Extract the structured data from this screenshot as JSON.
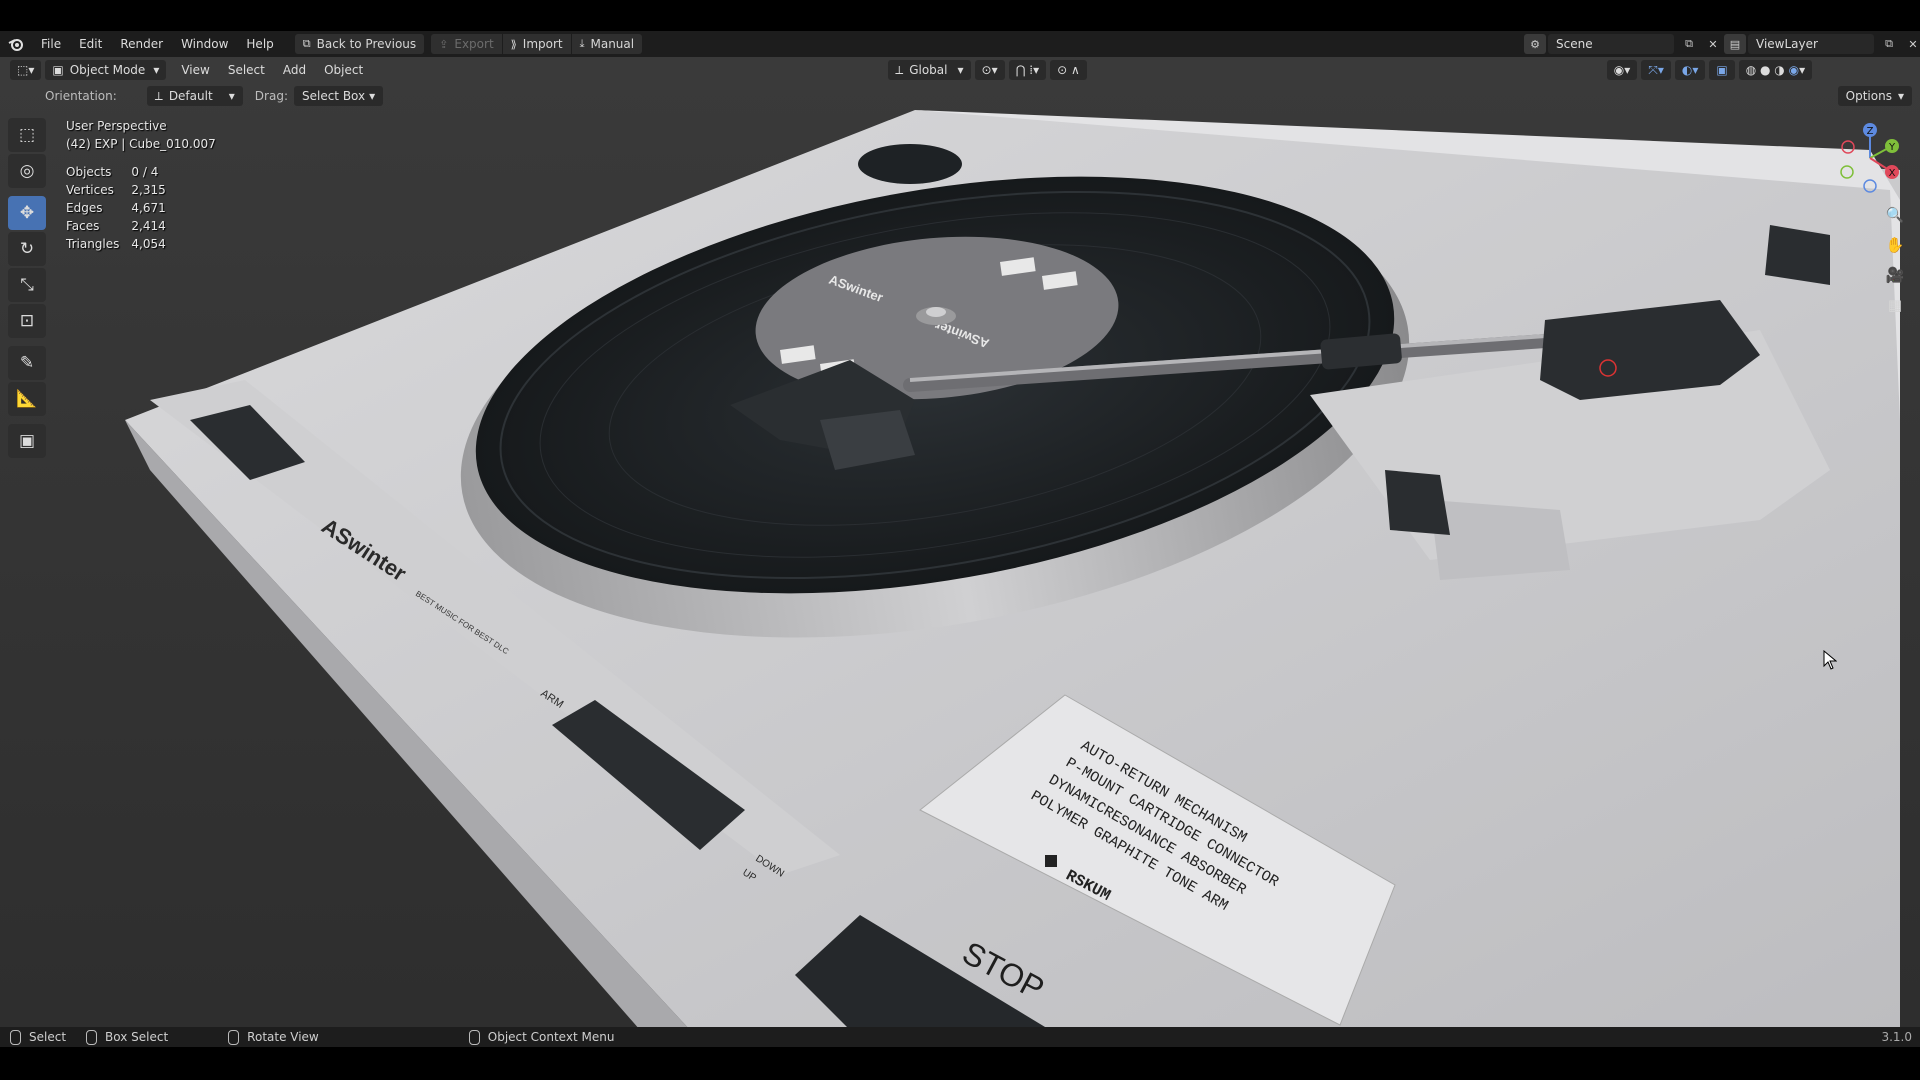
{
  "menubar": {
    "items": [
      "File",
      "Edit",
      "Render",
      "Window",
      "Help"
    ],
    "workspace_buttons": {
      "back": "Back to Previous",
      "export": "Export",
      "import": "Import",
      "manual": "Manual"
    },
    "scene": "Scene",
    "view_layer": "ViewLayer"
  },
  "viewport_header": {
    "mode": "Object Mode",
    "menus": [
      "View",
      "Select",
      "Add",
      "Object"
    ],
    "transform_orientation": "Global"
  },
  "tool_settings": {
    "orientation_label": "Orientation:",
    "orientation_value": "Default",
    "drag_label": "Drag:",
    "drag_value": "Select Box",
    "options": "Options"
  },
  "overlay": {
    "view_name": "User Perspective",
    "object_info": "(42) EXP | Cube_010.007"
  },
  "stats": [
    {
      "label": "Objects",
      "value": "0 / 4"
    },
    {
      "label": "Vertices",
      "value": "2,315"
    },
    {
      "label": "Edges",
      "value": "4,671"
    },
    {
      "label": "Faces",
      "value": "2,414"
    },
    {
      "label": "Triangles",
      "value": "4,054"
    }
  ],
  "scene_text": {
    "label_brand": "ASwinter",
    "label_tagline": "BEST MUSIC FOR BEST DLC",
    "arm": "ARM",
    "down": "DOWN",
    "up": "UP",
    "stop": "STOP",
    "features": [
      "AUTO-RETURN MECHANISM",
      "P-MOUNT CARTRIDGE CONNECTOR",
      "DYNAMICRESONANCE ABSORBER",
      "POLYMER GRAPHITE TONE ARM"
    ],
    "model": "RSKUM"
  },
  "statusbar": {
    "select": "Select",
    "box_select": "Box Select",
    "rotate_view": "Rotate View",
    "context_menu": "Object Context Menu",
    "version": "3.1.0"
  },
  "colors": {
    "accent": "#4772b3",
    "header_bg": "#1d1d1d",
    "deck": "#d7d7d9",
    "vinyl": "#1f2326"
  }
}
